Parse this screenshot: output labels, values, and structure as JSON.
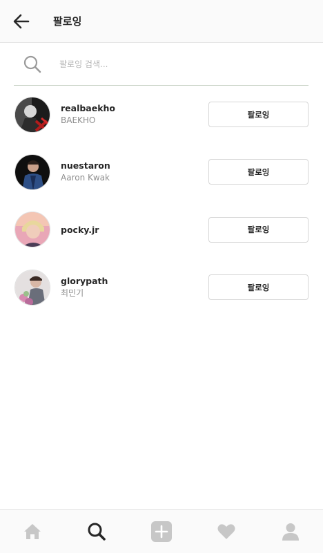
{
  "header": {
    "title": "팔로잉",
    "back_icon": "arrow-left-icon"
  },
  "search": {
    "placeholder": "팔로잉 검색...",
    "icon": "search-icon"
  },
  "users": [
    {
      "username": "realbaekho",
      "fullname": "BAEKHO",
      "button_label": "팔로잉"
    },
    {
      "username": "nuestaron",
      "fullname": "Aaron Kwak",
      "button_label": "팔로잉"
    },
    {
      "username": "pocky.jr",
      "fullname": "",
      "button_label": "팔로잉"
    },
    {
      "username": "glorypath",
      "fullname": "최민기",
      "button_label": "팔로잉"
    }
  ],
  "bottom_nav": {
    "items": [
      "home-icon",
      "search-icon",
      "add-icon",
      "heart-icon",
      "profile-icon"
    ],
    "active": "search-icon"
  },
  "colors": {
    "text": "#262626",
    "secondary": "#8e8e8e",
    "nav_inactive": "#c7c7c7",
    "nav_active": "#262626"
  }
}
